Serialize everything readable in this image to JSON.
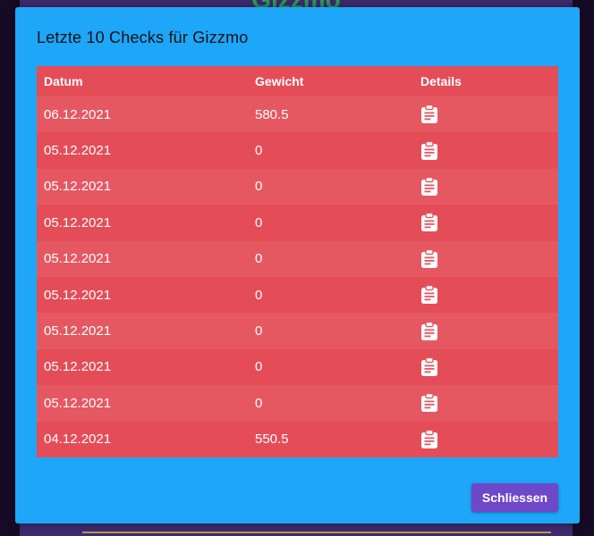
{
  "background": {
    "title": "Gizzmo"
  },
  "modal": {
    "title": "Letzte 10 Checks für Gizzmo",
    "close_label": "Schliessen"
  },
  "table": {
    "headers": [
      "Datum",
      "Gewicht",
      "Details"
    ],
    "rows": [
      {
        "date": "06.12.2021",
        "weight": "580.5",
        "details_icon": "clipboard-icon"
      },
      {
        "date": "05.12.2021",
        "weight": "0",
        "details_icon": "clipboard-icon"
      },
      {
        "date": "05.12.2021",
        "weight": "0",
        "details_icon": "clipboard-icon"
      },
      {
        "date": "05.12.2021",
        "weight": "0",
        "details_icon": "clipboard-icon"
      },
      {
        "date": "05.12.2021",
        "weight": "0",
        "details_icon": "clipboard-icon"
      },
      {
        "date": "05.12.2021",
        "weight": "0",
        "details_icon": "clipboard-icon"
      },
      {
        "date": "05.12.2021",
        "weight": "0",
        "details_icon": "clipboard-icon"
      },
      {
        "date": "05.12.2021",
        "weight": "0",
        "details_icon": "clipboard-icon"
      },
      {
        "date": "05.12.2021",
        "weight": "0",
        "details_icon": "clipboard-icon"
      },
      {
        "date": "04.12.2021",
        "weight": "550.5",
        "details_icon": "clipboard-icon"
      }
    ]
  },
  "colors": {
    "modal_bg": "#1ea6f8",
    "table_header": "#e44d58",
    "row_light": "#e55862",
    "row_dark": "#e44d58",
    "button": "#6f47c9",
    "backdrop": "#3f2a6e"
  }
}
